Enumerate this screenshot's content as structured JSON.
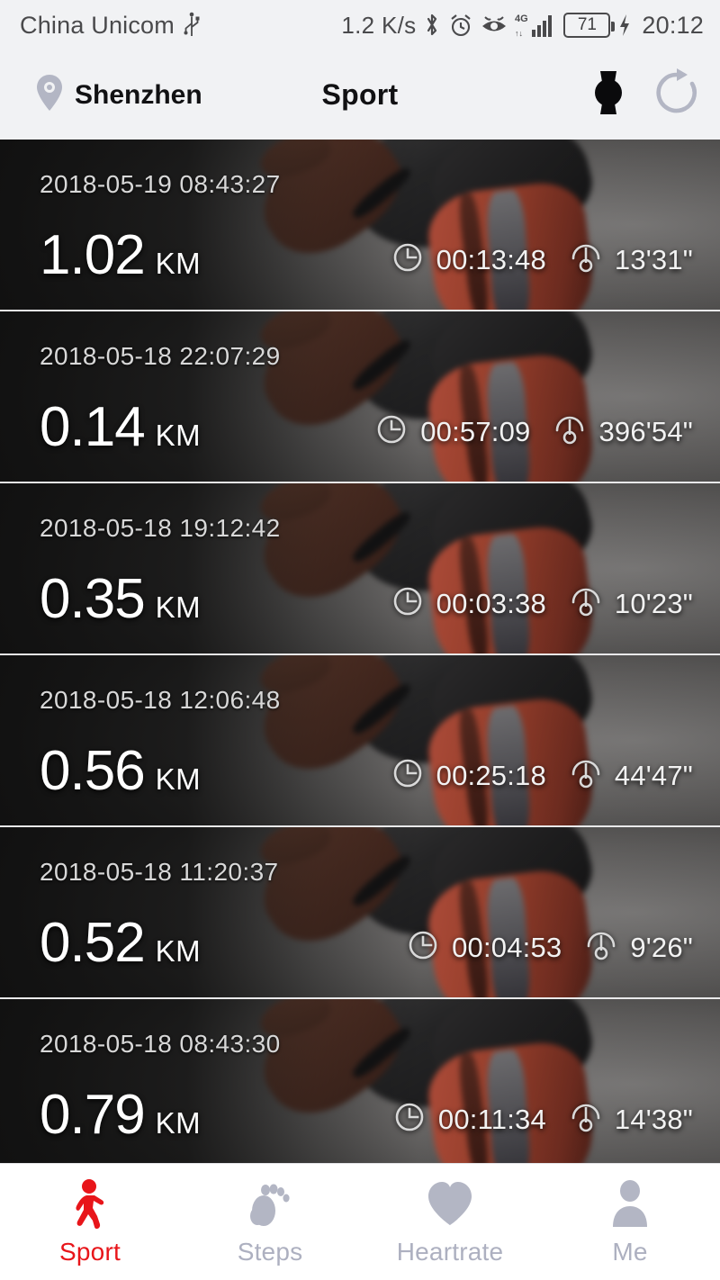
{
  "status_bar": {
    "carrier": "China Unicom",
    "usb_icon": "usb-icon",
    "net_speed": "1.2 K/s",
    "bluetooth_icon": "bluetooth-icon",
    "alarm_icon": "alarm-clock-icon",
    "eye_care_icon": "eye-comfort-icon",
    "network_type": "4G",
    "signal_icon": "signal-bars-icon",
    "battery_level": "71",
    "charging_icon": "charging-bolt-icon",
    "time": "20:12"
  },
  "app_bar": {
    "location_icon": "location-pin-icon",
    "location": "Shenzhen",
    "title": "Sport",
    "watch_icon": "smartwatch-icon",
    "sync_icon": "sync-refresh-icon"
  },
  "colors": {
    "accent_red": "#e8151a",
    "nav_inactive": "#adb0c0",
    "statusbar_bg": "#f1f2f4"
  },
  "list": {
    "duration_icon": "clock-icon",
    "pace_icon": "speedometer-icon",
    "unit": "KM",
    "records": [
      {
        "date": "2018-05-19 08:43:27",
        "distance": "1.02",
        "unit": "KM",
        "duration": "00:13:48",
        "pace": "13'31\""
      },
      {
        "date": "2018-05-18 22:07:29",
        "distance": "0.14",
        "unit": "KM",
        "duration": "00:57:09",
        "pace": "396'54\""
      },
      {
        "date": "2018-05-18 19:12:42",
        "distance": "0.35",
        "unit": "KM",
        "duration": "00:03:38",
        "pace": "10'23\""
      },
      {
        "date": "2018-05-18 12:06:48",
        "distance": "0.56",
        "unit": "KM",
        "duration": "00:25:18",
        "pace": "44'47\""
      },
      {
        "date": "2018-05-18 11:20:37",
        "distance": "0.52",
        "unit": "KM",
        "duration": "00:04:53",
        "pace": "9'26\""
      },
      {
        "date": "2018-05-18 08:43:30",
        "distance": "0.79",
        "unit": "KM",
        "duration": "00:11:34",
        "pace": "14'38\""
      }
    ]
  },
  "bottom_nav": {
    "items": [
      {
        "label": "Sport",
        "icon": "running-person-icon",
        "active": true
      },
      {
        "label": "Steps",
        "icon": "footprint-icon",
        "active": false
      },
      {
        "label": "Heartrate",
        "icon": "heart-icon",
        "active": false
      },
      {
        "label": "Me",
        "icon": "person-icon",
        "active": false
      }
    ]
  }
}
